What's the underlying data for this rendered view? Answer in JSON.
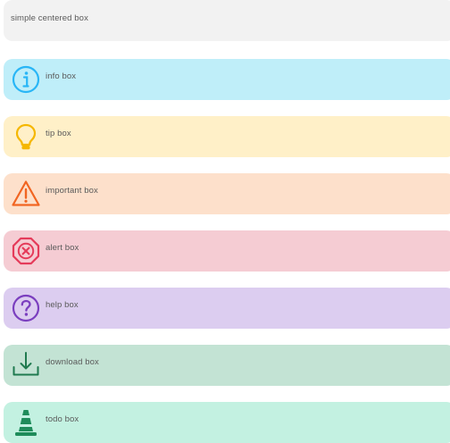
{
  "boxes": {
    "simple": {
      "label": "simple centered box"
    },
    "info": {
      "label": "info box",
      "icon": "info-icon",
      "color": "#29b6f6"
    },
    "tip": {
      "label": "tip box",
      "icon": "lightbulb-icon",
      "color": "#f5b700"
    },
    "important": {
      "label": "important box",
      "icon": "warning-icon",
      "color": "#f16522"
    },
    "alert": {
      "label": "alert box",
      "icon": "alert-icon",
      "color": "#e53b5a"
    },
    "help": {
      "label": "help box",
      "icon": "help-icon",
      "color": "#7b3fbf"
    },
    "download": {
      "label": "download box",
      "icon": "download-icon",
      "color": "#1f7a4f"
    },
    "todo": {
      "label": "todo box",
      "icon": "cone-icon",
      "color": "#1e8c5a"
    }
  }
}
